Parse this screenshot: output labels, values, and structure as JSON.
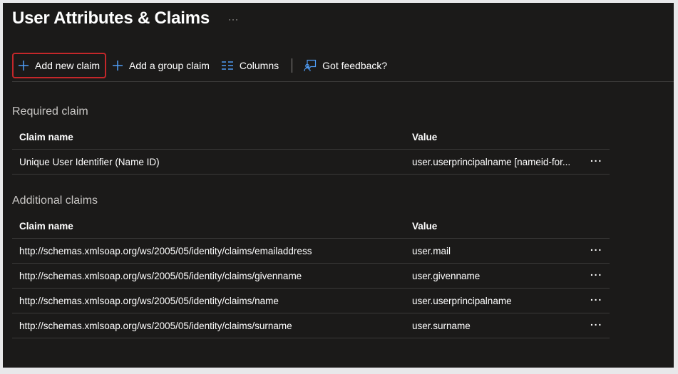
{
  "page": {
    "title": "User Attributes & Claims",
    "title_more": "···"
  },
  "toolbar": {
    "add_new_claim": "Add new claim",
    "add_group_claim": "Add a group claim",
    "columns": "Columns",
    "feedback": "Got feedback?"
  },
  "required": {
    "label": "Required claim",
    "headers": {
      "name": "Claim name",
      "value": "Value"
    },
    "rows": [
      {
        "name": "Unique User Identifier (Name ID)",
        "value": "user.userprincipalname [nameid-for..."
      }
    ]
  },
  "additional": {
    "label": "Additional claims",
    "headers": {
      "name": "Claim name",
      "value": "Value"
    },
    "rows": [
      {
        "name": "http://schemas.xmlsoap.org/ws/2005/05/identity/claims/emailaddress",
        "value": "user.mail"
      },
      {
        "name": "http://schemas.xmlsoap.org/ws/2005/05/identity/claims/givenname",
        "value": "user.givenname"
      },
      {
        "name": "http://schemas.xmlsoap.org/ws/2005/05/identity/claims/name",
        "value": "user.userprincipalname"
      },
      {
        "name": "http://schemas.xmlsoap.org/ws/2005/05/identity/claims/surname",
        "value": "user.surname"
      }
    ]
  },
  "row_more": "···",
  "colors": {
    "background": "#1b1a19",
    "accent": "#4f9cf5",
    "highlight_border": "#c4272a"
  },
  "icons": [
    "plus-icon",
    "columns-icon",
    "feedback-icon",
    "more-icon"
  ]
}
